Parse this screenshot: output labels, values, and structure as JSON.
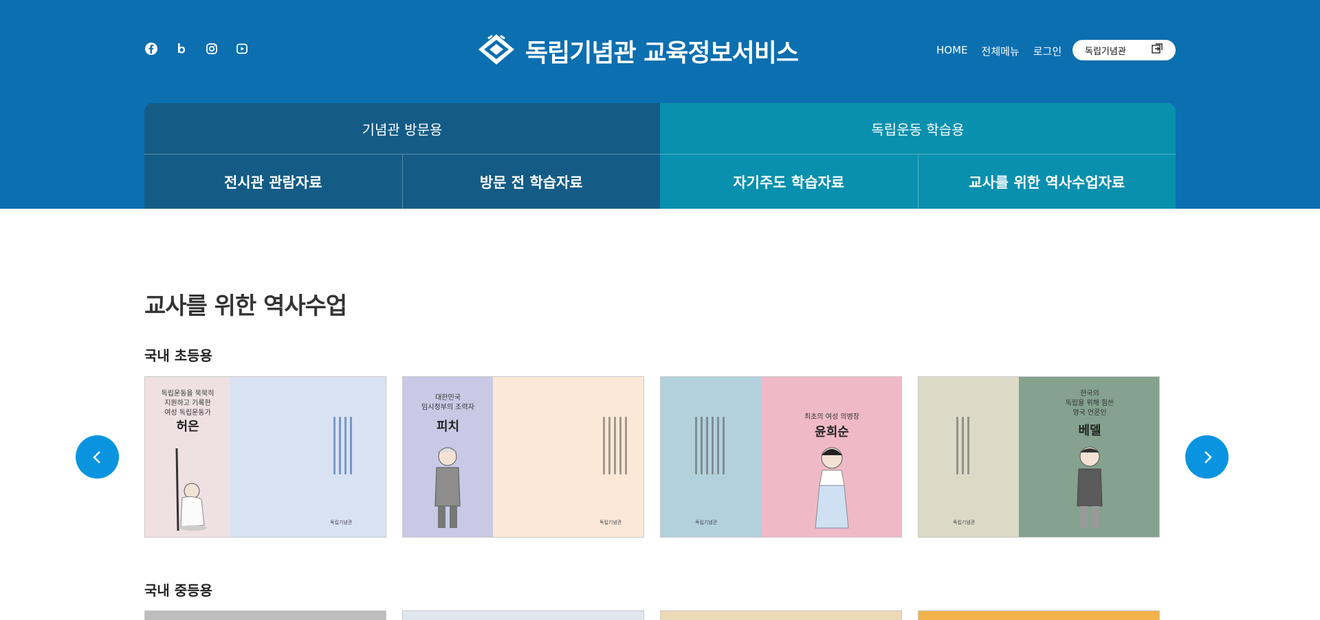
{
  "header": {
    "logo_text": "독립기념관 교육정보서비스",
    "social_icons": [
      "facebook-icon",
      "blog-icon",
      "instagram-icon",
      "youtube-icon"
    ],
    "topnav": {
      "home": "HOME",
      "all_menu": "전체메뉴",
      "login": "로그인"
    },
    "site_select": "독립기념관",
    "colors": {
      "header_bg": "#0b6fb0",
      "menu_left": "#145c86",
      "menu_right": "#0890ae"
    }
  },
  "menu": {
    "left": {
      "title": "기념관 방문용",
      "subs": [
        "전시관 관람자료",
        "방문 전 학습자료"
      ]
    },
    "right": {
      "title": "독립운동 학습용",
      "subs": [
        "자기주도 학습자료",
        "교사를 위한 역사수업자료"
      ]
    }
  },
  "page_title": "교사를 위한 역사수업",
  "sections": [
    {
      "title": "국내 초등용",
      "cards": [
        {
          "subtitle": "독립운동을 묵묵히\n지원하고 기록한\n여성 독립운동가",
          "name": "허은",
          "left_color": "#efe0e4",
          "right_color": "#d9e2f2"
        },
        {
          "subtitle": "대한민국\n임시정부의 조력자",
          "name": "피치",
          "left_color": "#c9c9e6",
          "right_color": "#fce8d6"
        },
        {
          "subtitle": "최초의 여성 의병장",
          "name": "윤희순",
          "left_color": "#b2d1dc",
          "right_color": "#efbac6"
        },
        {
          "subtitle": "한국의\n독립을 위해 힘쓴\n영국 언론인",
          "name": "베델",
          "left_color": "#dcdac7",
          "right_color": "#84a28e"
        }
      ],
      "publisher": "독립기념관"
    },
    {
      "title": "국내 중등용"
    }
  ]
}
